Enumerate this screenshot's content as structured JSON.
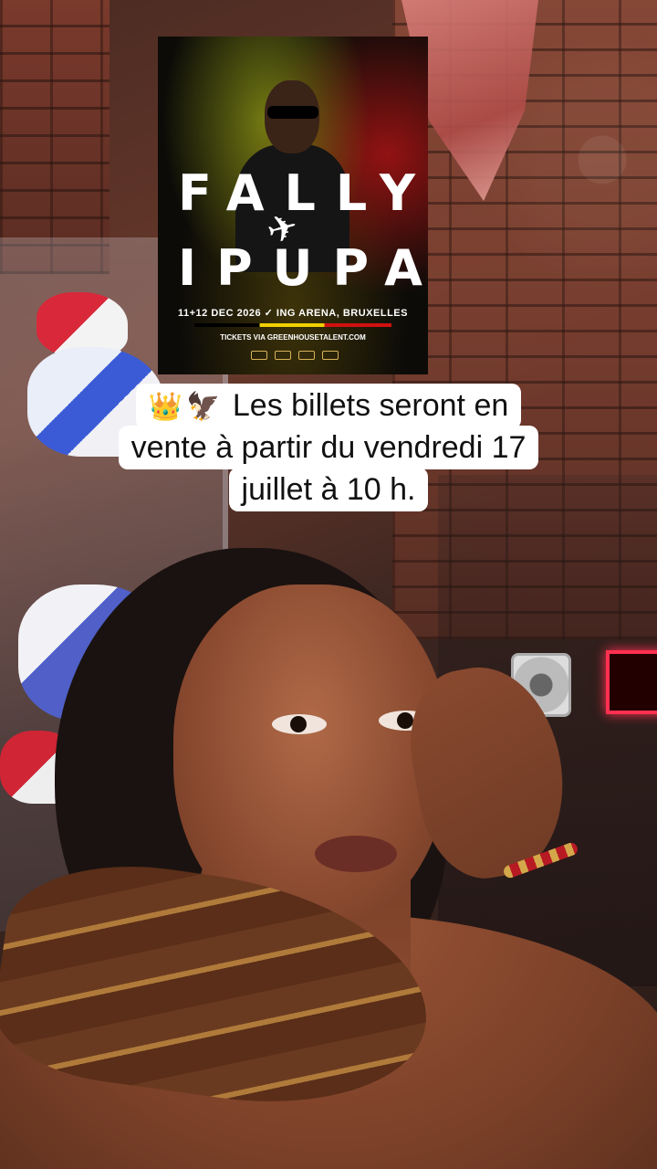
{
  "poster": {
    "name_first": "FALLY",
    "name_last": "IPUPA",
    "date_venue": "11+12 DEC 2026 ✓ ING ARENA, BRUXELLES",
    "tickets": "TICKETS VIA GREENHOUSETALENT.COM",
    "flag_colors": [
      "#000000",
      "#f0d000",
      "#d01010"
    ]
  },
  "caption": {
    "emojis": [
      "👑",
      "🦅"
    ],
    "line1": "Les billets seront en",
    "line2": "vente à partir du vendredi 17",
    "line3": "juillet à 10 h."
  }
}
